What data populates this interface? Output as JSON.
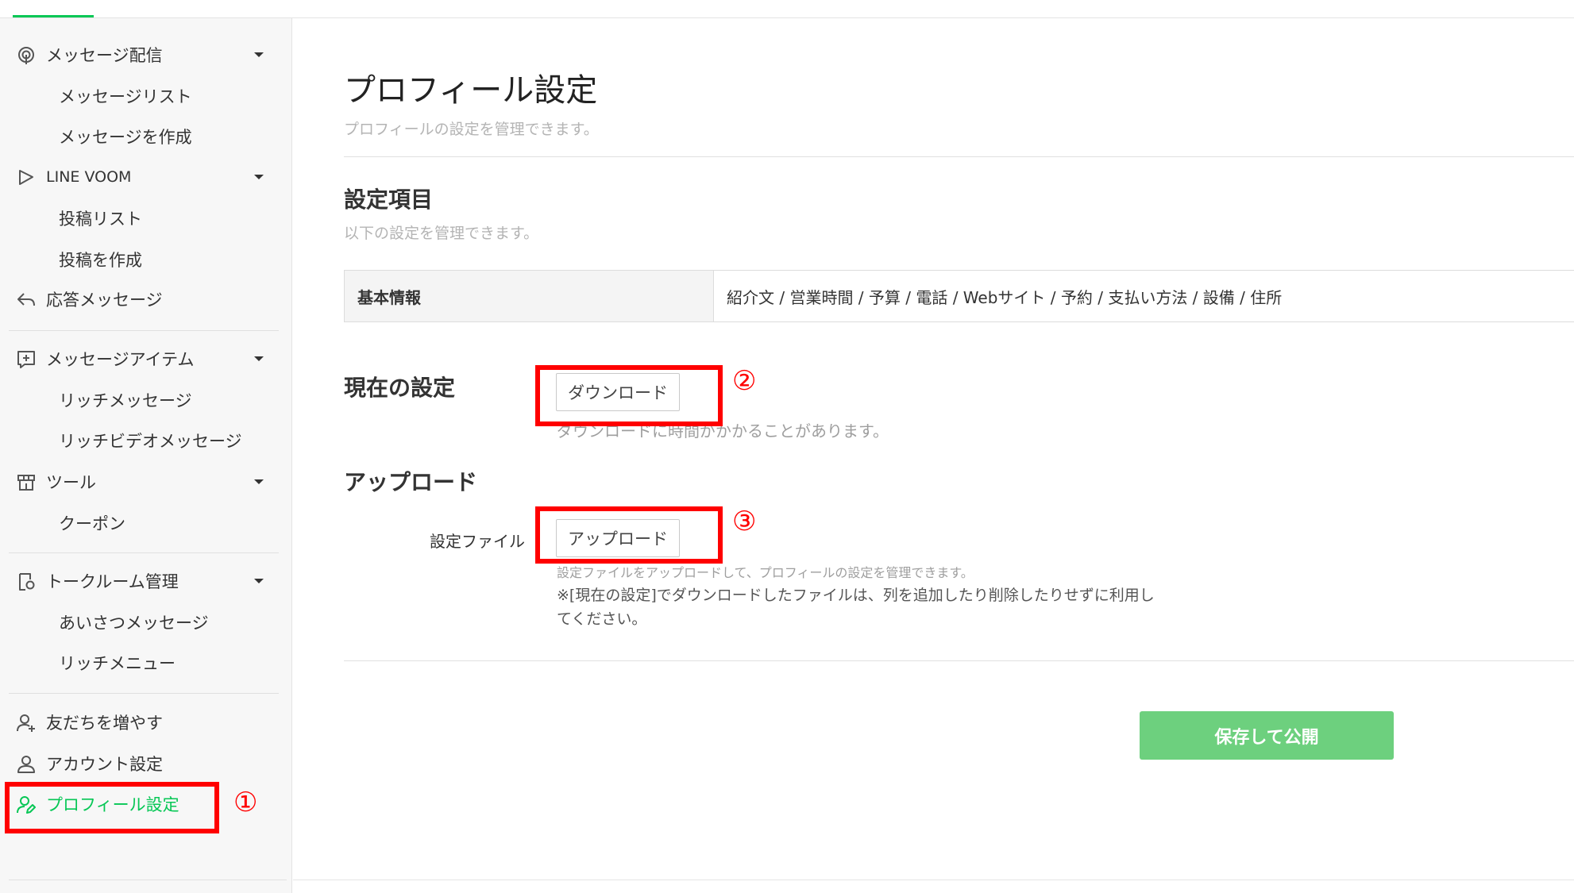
{
  "sidebar": {
    "message_delivery": {
      "label": "メッセージ配信",
      "items": [
        "メッセージリスト",
        "メッセージを作成"
      ]
    },
    "line_voom": {
      "label": "LINE VOOM",
      "items": [
        "投稿リスト",
        "投稿を作成"
      ]
    },
    "auto_reply": {
      "label": "応答メッセージ"
    },
    "message_items": {
      "label": "メッセージアイテム",
      "items": [
        "リッチメッセージ",
        "リッチビデオメッセージ"
      ]
    },
    "tools": {
      "label": "ツール",
      "items": [
        "クーポン"
      ]
    },
    "chat_room": {
      "label": "トークルーム管理",
      "items": [
        "あいさつメッセージ",
        "リッチメニュー"
      ]
    },
    "grow_friends": {
      "label": "友だちを増やす"
    },
    "account_settings": {
      "label": "アカウント設定"
    },
    "profile_settings": {
      "label": "プロフィール設定"
    }
  },
  "annotations": [
    "①",
    "②",
    "③"
  ],
  "main": {
    "title": "プロフィール設定",
    "description": "プロフィールの設定を管理できます。",
    "settings_section": {
      "title": "設定項目",
      "description": "以下の設定を管理できます。",
      "table": {
        "head": "基本情報",
        "value": "紹介文 / 営業時間 / 予算 / 電話 / Webサイト / 予約 / 支払い方法 / 設備 / 住所"
      }
    },
    "current_section": {
      "title": "現在の設定",
      "download_button": "ダウンロード",
      "hint": "ダウンロードに時間がかかることがあります。"
    },
    "upload_section": {
      "title": "アップロード",
      "field_label": "設定ファイル",
      "upload_button": "アップロード",
      "hint": "設定ファイルをアップロードして、プロフィールの設定を管理できます。",
      "note": "※[現在の設定]でダウンロードしたファイルは、列を追加したり削除したりせずに利用してください。"
    },
    "save_button": "保存して公開"
  },
  "colors": {
    "brand_green": "#06c755",
    "save_button": "#6dd07e",
    "annotation_red": "#ff0000"
  }
}
